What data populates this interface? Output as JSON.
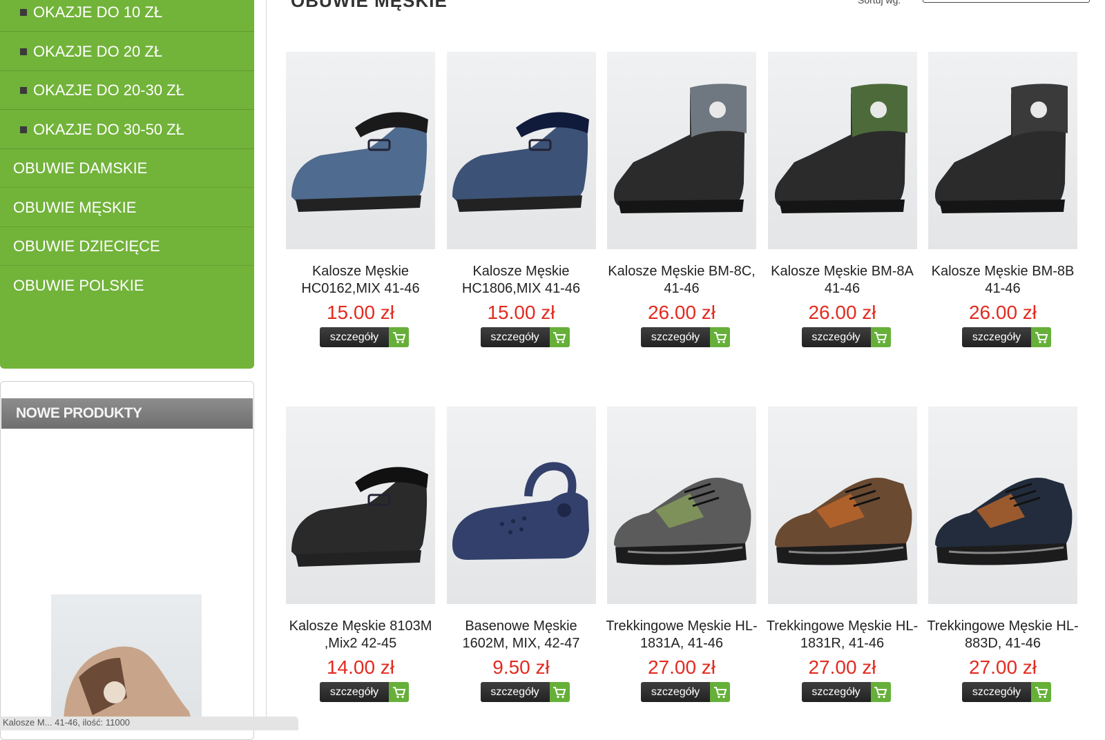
{
  "sidebar": {
    "categories": [
      {
        "label": "OKAZJE DO 10 ZŁ",
        "sub": true
      },
      {
        "label": "OKAZJE DO 20 ZŁ",
        "sub": true
      },
      {
        "label": "OKAZJE DO 20-30 ZŁ",
        "sub": true
      },
      {
        "label": "OKAZJE DO 30-50 ZŁ",
        "sub": true
      },
      {
        "label": "OBUWIE DAMSKIE",
        "sub": false
      },
      {
        "label": "OBUWIE MĘSKIE",
        "sub": false
      },
      {
        "label": "OBUWIE DZIECIĘCE",
        "sub": false
      },
      {
        "label": "OBUWIE POLSKIE",
        "sub": false
      }
    ],
    "new_products_title": "NOWE PRODUKTY",
    "tooltip_text": "Kalosze M... 41-46, ilość: 11000"
  },
  "header": {
    "title": "OBUWIE MĘSKIE",
    "sort_label": "Sortuj wg:"
  },
  "button_label": "szczegóły",
  "colors": {
    "sidebar_green": "#72b33a",
    "price_red": "#e32a1f",
    "cart_green": "#66b03a"
  },
  "products": [
    {
      "name": "Kalosze Męskie HC0162,MIX 41-46",
      "price": "15.00 zł",
      "shape": "clog",
      "color": "#4f6b8f",
      "lining": "#1a1a1a"
    },
    {
      "name": "Kalosze Męskie HC1806,MIX 41-46",
      "price": "15.00 zł",
      "shape": "clog",
      "color": "#3d5277",
      "lining": "#101a3a"
    },
    {
      "name": "Kalosze Męskie BM-8C, 41-46",
      "price": "26.00 zł",
      "shape": "boot",
      "color": "#2b2b2b",
      "lining": "#6f7880"
    },
    {
      "name": "Kalosze Męskie BM-8A 41-46",
      "price": "26.00 zł",
      "shape": "boot",
      "color": "#2b2b2b",
      "lining": "#4d6b3a"
    },
    {
      "name": "Kalosze Męskie BM-8B 41-46",
      "price": "26.00 zł",
      "shape": "boot",
      "color": "#2b2b2b",
      "lining": "#3a3a3a"
    },
    {
      "name": "Kalosze Męskie 8103M ,Mix2 42-45",
      "price": "14.00 zł",
      "shape": "clog",
      "color": "#2a2a2a",
      "lining": "#111111"
    },
    {
      "name": "Basenowe Męskie 1602M, MIX, 42-47",
      "price": "9.50 zł",
      "shape": "croc",
      "color": "#32406b",
      "lining": "#32406b"
    },
    {
      "name": "Trekkingowe Męskie HL-1831A, 41-46",
      "price": "27.00 zł",
      "shape": "sneaker",
      "color": "#5b5b5b",
      "lining": "#8aa35a"
    },
    {
      "name": "Trekkingowe Męskie HL-1831R, 41-46",
      "price": "27.00 zł",
      "shape": "sneaker",
      "color": "#6b4a32",
      "lining": "#c46a2a"
    },
    {
      "name": "Trekkingowe Męskie HL-883D, 41-46",
      "price": "27.00 zł",
      "shape": "sneaker",
      "color": "#222c3c",
      "lining": "#c46a2a"
    }
  ]
}
